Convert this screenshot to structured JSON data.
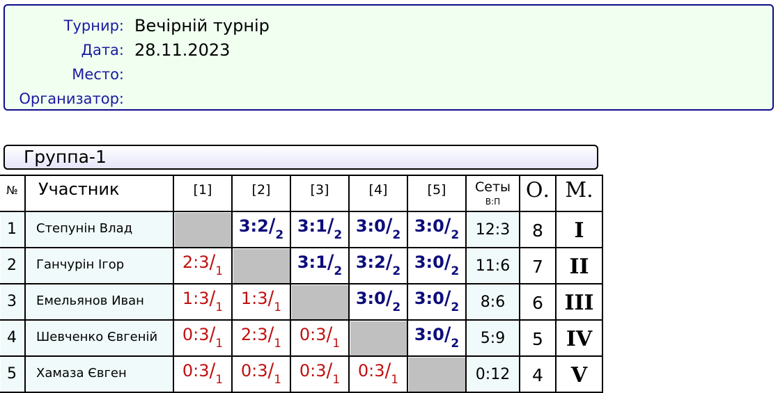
{
  "info": {
    "tournament_label": "Турнир:",
    "tournament_value": "Вечірній турнір",
    "date_label": "Дата:",
    "date_value": "28.11.2023",
    "place_label": "Место:",
    "place_value": "",
    "organizer_label": "Организатор:",
    "organizer_value": ""
  },
  "group": {
    "title": "Группа-1"
  },
  "table": {
    "headers": {
      "num": "№",
      "participant": "Участник",
      "c1": "[1]",
      "c2": "[2]",
      "c3": "[3]",
      "c4": "[4]",
      "c5": "[5]",
      "sets": "Сеты",
      "sets_sub": "В:П",
      "points": "О.",
      "place": "М."
    },
    "rows": [
      {
        "num": "1",
        "name": "Степунін Влад",
        "results": [
          null,
          {
            "score": "3:2",
            "pts": "2",
            "win": true
          },
          {
            "score": "3:1",
            "pts": "2",
            "win": true
          },
          {
            "score": "3:0",
            "pts": "2",
            "win": true
          },
          {
            "score": "3:0",
            "pts": "2",
            "win": true
          }
        ],
        "sets": "12:3",
        "points": "8",
        "place": "I"
      },
      {
        "num": "2",
        "name": "Ганчурін Ігор",
        "results": [
          {
            "score": "2:3",
            "pts": "1",
            "win": false
          },
          null,
          {
            "score": "3:1",
            "pts": "2",
            "win": true
          },
          {
            "score": "3:2",
            "pts": "2",
            "win": true
          },
          {
            "score": "3:0",
            "pts": "2",
            "win": true
          }
        ],
        "sets": "11:6",
        "points": "7",
        "place": "II"
      },
      {
        "num": "3",
        "name": "Емельянов Иван",
        "results": [
          {
            "score": "1:3",
            "pts": "1",
            "win": false
          },
          {
            "score": "1:3",
            "pts": "1",
            "win": false
          },
          null,
          {
            "score": "3:0",
            "pts": "2",
            "win": true
          },
          {
            "score": "3:0",
            "pts": "2",
            "win": true
          }
        ],
        "sets": "8:6",
        "points": "6",
        "place": "III"
      },
      {
        "num": "4",
        "name": "Шевченко Євгеній",
        "results": [
          {
            "score": "0:3",
            "pts": "1",
            "win": false
          },
          {
            "score": "2:3",
            "pts": "1",
            "win": false
          },
          {
            "score": "0:3",
            "pts": "1",
            "win": false
          },
          null,
          {
            "score": "3:0",
            "pts": "2",
            "win": true
          }
        ],
        "sets": "5:9",
        "points": "5",
        "place": "IV"
      },
      {
        "num": "5",
        "name": "Хамаза Євген",
        "results": [
          {
            "score": "0:3",
            "pts": "1",
            "win": false
          },
          {
            "score": "0:3",
            "pts": "1",
            "win": false
          },
          {
            "score": "0:3",
            "pts": "1",
            "win": false
          },
          {
            "score": "0:3",
            "pts": "1",
            "win": false
          },
          null
        ],
        "sets": "0:12",
        "points": "4",
        "place": "V"
      }
    ]
  },
  "colors": {
    "win": "#0c0c7a",
    "loss": "#c01010",
    "info_label": "#1a1aa0",
    "panel_bg": "#f0fff0",
    "self_cell": "#c0c0c0"
  }
}
